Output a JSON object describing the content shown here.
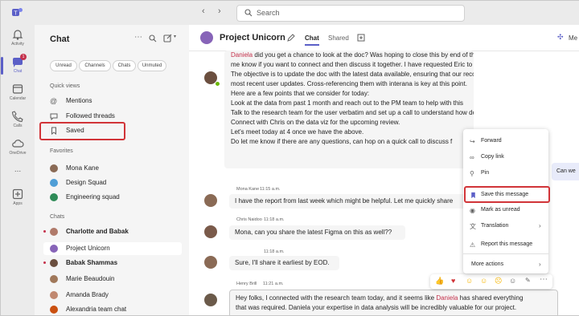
{
  "search": {
    "placeholder": "Search"
  },
  "rail": [
    {
      "label": "Activity"
    },
    {
      "label": "Chat",
      "badge": "1"
    },
    {
      "label": "Calendar"
    },
    {
      "label": "Calls"
    },
    {
      "label": "OneDrive"
    },
    {
      "label": "..."
    },
    {
      "label": "Apps"
    }
  ],
  "list": {
    "title": "Chat",
    "filters": [
      "Unread",
      "Channels",
      "Chats",
      "Unmuted"
    ],
    "quick_views_label": "Quick views",
    "quick_views": [
      "Mentions",
      "Followed threads",
      "Saved"
    ],
    "favorites_label": "Favorites",
    "favorites": [
      "Mona Kane",
      "Design Squad",
      "Engineering squad"
    ],
    "chats_label": "Chats",
    "chats": [
      "Charlotte and Babak",
      "Project Unicorn",
      "Babak Shammas",
      "Marie Beaudouin",
      "Amanda Brady",
      "Alexandria team chat"
    ]
  },
  "header": {
    "title": "Project Unicorn",
    "tabs": [
      "Chat",
      "Shared"
    ],
    "right_label": "Me"
  },
  "thread": {
    "first_msg": {
      "mention": "Daniela",
      "line1": " did you get a chance to look at the doc? Was hoping to close this by end of the day. Do let",
      "lines": [
        "me know if you want to connect and then discuss it together. I have requested Eric to join too.",
        "The objective is to update the doc with the latest data available, ensuring that our records align with the",
        "most recent user updates. Cross-referencing them with interana is key at this point.",
        "Here are a few points that we consider for today:",
        "Look at the data from past 1 month and reach out to the PM team to help with this",
        "Talk to the research team for the user verbatim and set up a call to understand how do we plan ahead.",
        "Connect with Chris on the data viz for the upcoming review.",
        "Let's meet today at 4 once we have the above.",
        "Do let me know if there are any questions, can hop on a quick call to discuss f"
      ]
    },
    "side_snippet": "Can we",
    "messages": [
      {
        "author": "Mona Kane",
        "time": "11:15 a.m.",
        "text": "I have the report from last week which might be helpful. Let me quickly share"
      },
      {
        "author": "Chris Naidoo",
        "time": "11:18 a.m.",
        "text": "Mona, can you share the latest Figma on this as well??"
      },
      {
        "author": "",
        "time": "11:18 a.m.",
        "text": "Sure, I'll share it earliest by EOD."
      },
      {
        "author": "Henry Brill",
        "time": "11:21 a.m.",
        "text_pre": "Hey folks, I connected with the research team today, and it seems like ",
        "mention": "Daniela",
        "text_post": " has shared everything",
        "line2": "that was required. Daniela your expertise in data analysis will be incredibly valuable for our project."
      }
    ]
  },
  "context_menu": [
    "Forward",
    "Copy link",
    "Pin",
    "Save this message",
    "Mark as unread",
    "Translation",
    "Report this message",
    "More actions"
  ],
  "colors": {
    "accent": "#5b5fc7",
    "highlight": "#d13438",
    "mention": "#c4314b"
  }
}
